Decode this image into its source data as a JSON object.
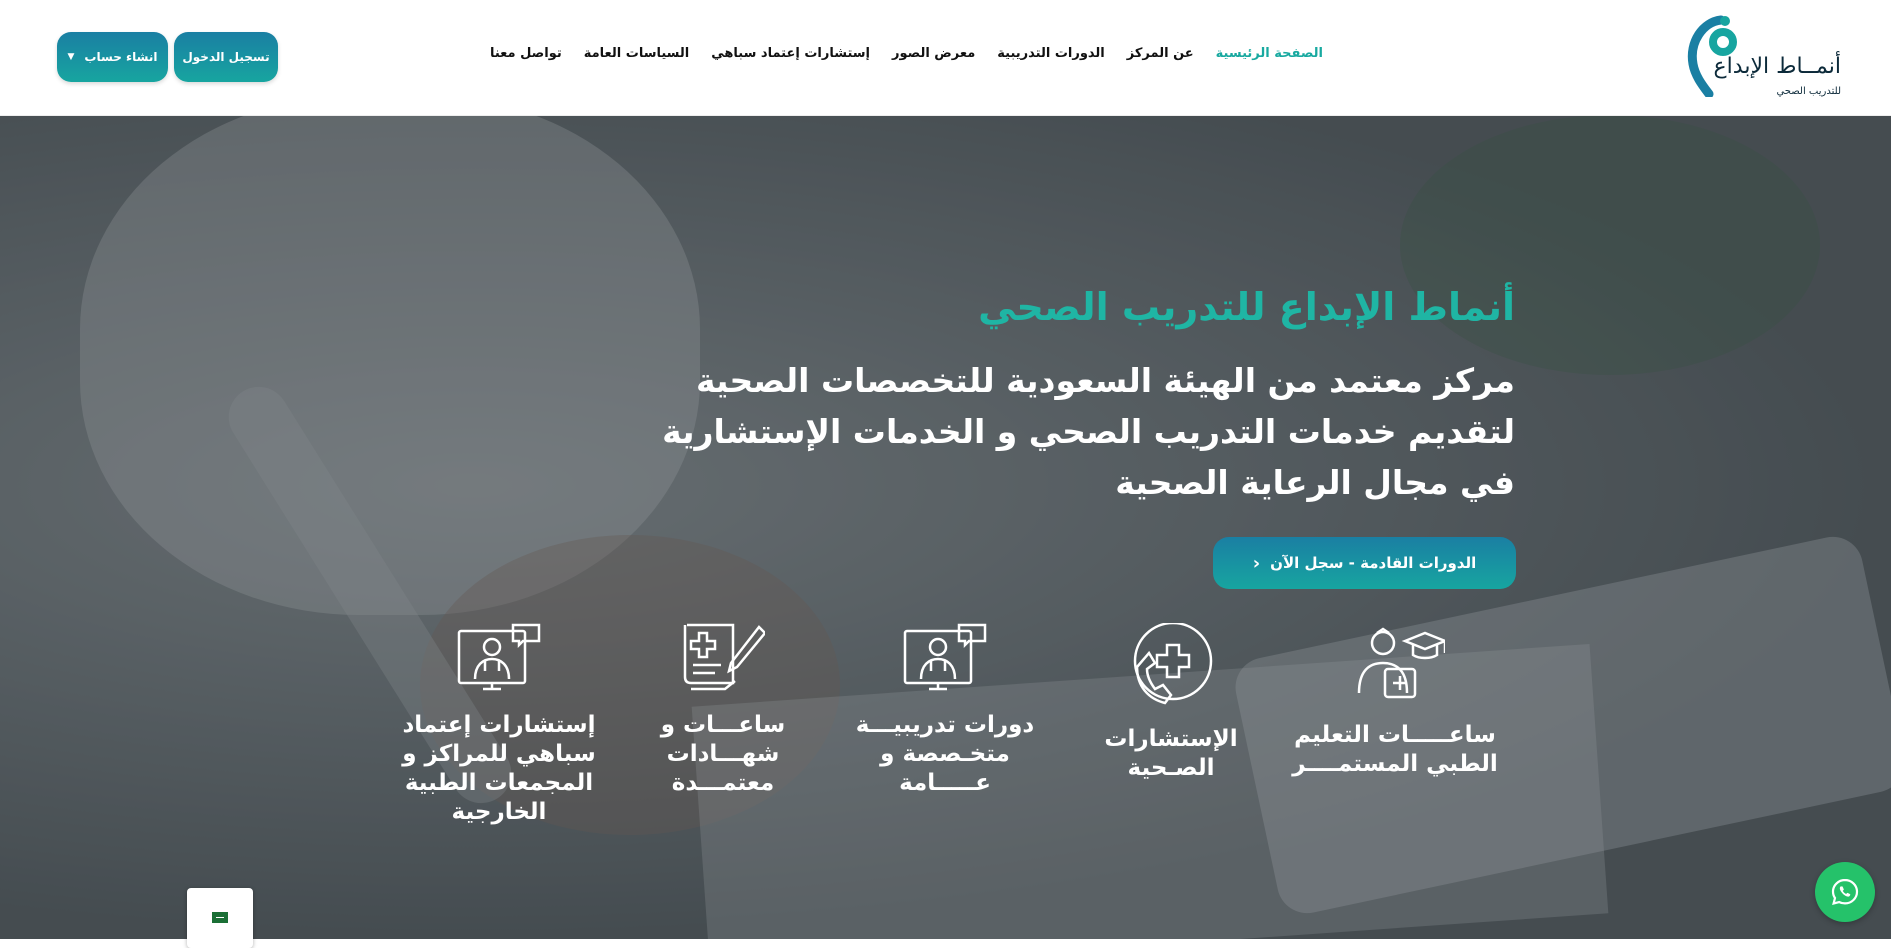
{
  "header": {
    "logo": {
      "name": "أنمــاط الإبداع",
      "sub": "للتدريب الصحي"
    },
    "nav": [
      {
        "label": "الصفحة الرئيسية",
        "active": true
      },
      {
        "label": "عن المركز"
      },
      {
        "label": "الدورات التدريبية"
      },
      {
        "label": "معرض الصور"
      },
      {
        "label": "إستشارات إعتماد سباهي"
      },
      {
        "label": "السياسات العامة"
      },
      {
        "label": "تواصل معنا"
      }
    ],
    "login_label": "تسجيل الدخول",
    "signup_label": "انشاء حساب"
  },
  "hero": {
    "title": "أنماط الإبداع للتدريب الصحي",
    "subtitle": "مركز معتمد من الهيئة السعودية للتخصصات الصحية لتقديم خدمات التدريب الصحي و الخدمات الإستشارية في مجال الرعاية الصحية",
    "cta_label": "الدورات القادمة - سجل الآن"
  },
  "features": [
    {
      "label": "ساعـــــات التعليم الطبي المستمــــر",
      "icon": "graduate-doctor-icon"
    },
    {
      "label": "الإستشارات الصـحية",
      "icon": "medical-phone-icon"
    },
    {
      "label": "دورات تدريبيـــة متخـصصة و عـــــامة",
      "icon": "online-doctor-icon"
    },
    {
      "label": "ساعـــات و شهـــادات معتمـــدة",
      "icon": "certificate-icon"
    },
    {
      "label": "إستشارات إعتماد سباهي للمراكز و المجمعات الطبية الخارجية",
      "icon": "online-consult-icon"
    }
  ],
  "colors": {
    "accent": "#18a9a0",
    "button_top": "#1a7fa3",
    "button_bottom": "#17a5a0",
    "whatsapp": "#25c26a"
  }
}
